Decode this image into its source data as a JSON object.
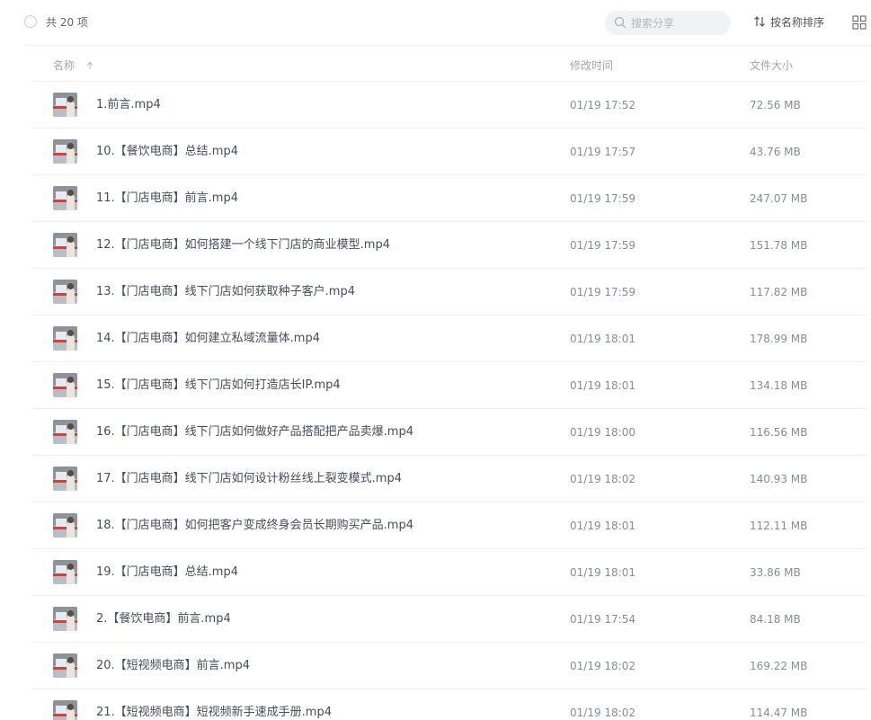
{
  "toolbar": {
    "count_text": "共 20 项",
    "search_placeholder": "搜索分享",
    "sort_label": "按名称排序"
  },
  "columns": {
    "name": "名称",
    "time": "修改时间",
    "size": "文件大小"
  },
  "icons": {
    "search": "search-icon",
    "sort": "sort-icon",
    "view": "grid-view-icon",
    "name_sort_arrow": "arrow-up-icon"
  },
  "files": [
    {
      "name": "1.前言.mp4",
      "time": "01/19 17:52",
      "size": "72.56 MB"
    },
    {
      "name": "10.【餐饮电商】总结.mp4",
      "time": "01/19 17:57",
      "size": "43.76 MB"
    },
    {
      "name": "11.【门店电商】前言.mp4",
      "time": "01/19 17:59",
      "size": "247.07 MB"
    },
    {
      "name": "12.【门店电商】如何搭建一个线下门店的商业模型.mp4",
      "time": "01/19 17:59",
      "size": "151.78 MB"
    },
    {
      "name": "13.【门店电商】线下门店如何获取种子客户.mp4",
      "time": "01/19 17:59",
      "size": "117.82 MB"
    },
    {
      "name": "14.【门店电商】如何建立私域流量体.mp4",
      "time": "01/19 18:01",
      "size": "178.99 MB"
    },
    {
      "name": "15.【门店电商】线下门店如何打造店长IP.mp4",
      "time": "01/19 18:01",
      "size": "134.18 MB"
    },
    {
      "name": "16.【门店电商】线下门店如何做好产品搭配把产品卖爆.mp4",
      "time": "01/19 18:00",
      "size": "116.56 MB"
    },
    {
      "name": "17.【门店电商】线下门店如何设计粉丝线上裂变模式.mp4",
      "time": "01/19 18:02",
      "size": "140.93 MB"
    },
    {
      "name": "18.【门店电商】如何把客户变成终身会员长期购买产品.mp4",
      "time": "01/19 18:01",
      "size": "112.11 MB"
    },
    {
      "name": "19.【门店电商】总结.mp4",
      "time": "01/19 18:01",
      "size": "33.86 MB"
    },
    {
      "name": "2.【餐饮电商】前言.mp4",
      "time": "01/19 17:54",
      "size": "84.18 MB"
    },
    {
      "name": "20.【短视频电商】前言.mp4",
      "time": "01/19 18:02",
      "size": "169.22 MB"
    },
    {
      "name": "21.【短视频电商】短视频新手速成手册.mp4",
      "time": "01/19 18:02",
      "size": "114.47 MB"
    }
  ]
}
